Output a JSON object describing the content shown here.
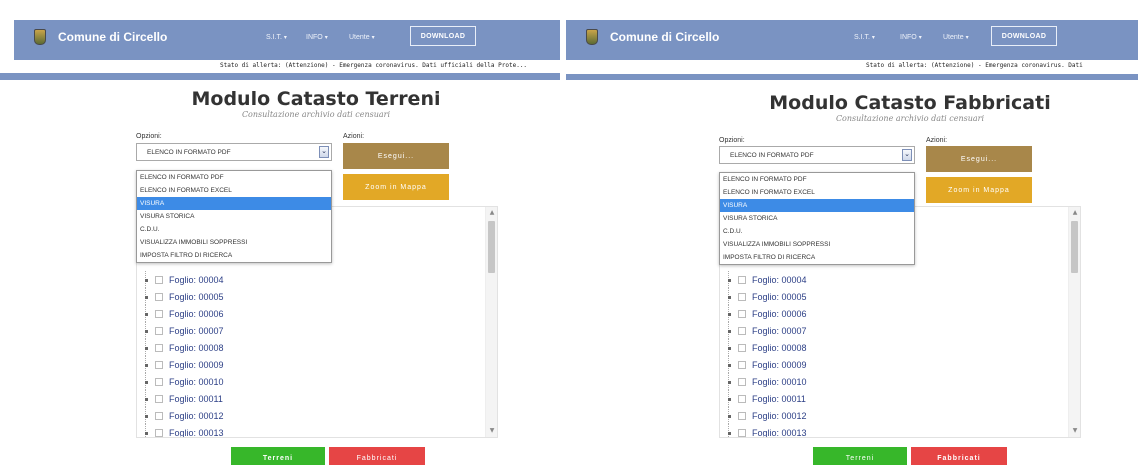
{
  "brand_title": "Comune di Circello",
  "nav": {
    "sit": "S.I.T.",
    "info": "INFO",
    "utente": "Utente",
    "download": "DOWNLOAD"
  },
  "ticker_text": "Stato di allerta: (Attenzione) - Emergenza coronavirus. Dati ufficiali della Prote...",
  "ticker_text_right": "Stato di allerta: (Attenzione) - Emergenza coronavirus. Dati",
  "labels": {
    "opzioni": "Opzioni:",
    "azioni": "Azioni:"
  },
  "select_value": "ELENCO IN FORMATO PDF",
  "buttons": {
    "esegui": "Esegui...",
    "zoom": "Zoom in Mappa",
    "terreni": "Terreni",
    "fabbricati": "Fabbricati"
  },
  "dropdown_options": [
    "ELENCO IN FORMATO PDF",
    "ELENCO IN FORMATO EXCEL",
    "VISURA",
    "VISURA STORICA",
    "C.D.U.",
    "VISUALIZZA IMMOBILI SOPPRESSI",
    "IMPOSTA FILTRO DI RICERCA"
  ],
  "left_panel": {
    "title": "Modulo Catasto Terreni",
    "subtitle": "Consultazione archivio dati censuari"
  },
  "right_panel": {
    "title": "Modulo Catasto Fabbricati",
    "subtitle": "Consultazione archivio dati censuari"
  },
  "tree_items": [
    "Foglio: 00004",
    "Foglio: 00005",
    "Foglio: 00006",
    "Foglio: 00007",
    "Foglio: 00008",
    "Foglio: 00009",
    "Foglio: 00010",
    "Foglio: 00011",
    "Foglio: 00012",
    "Foglio: 00013"
  ],
  "colors": {
    "navbar": "#7a93c2",
    "esegui": "#a8874a",
    "zoom": "#e2a826",
    "terreni": "#37b72a",
    "fabbricati": "#e64545",
    "selected_option": "#3d8be6"
  }
}
